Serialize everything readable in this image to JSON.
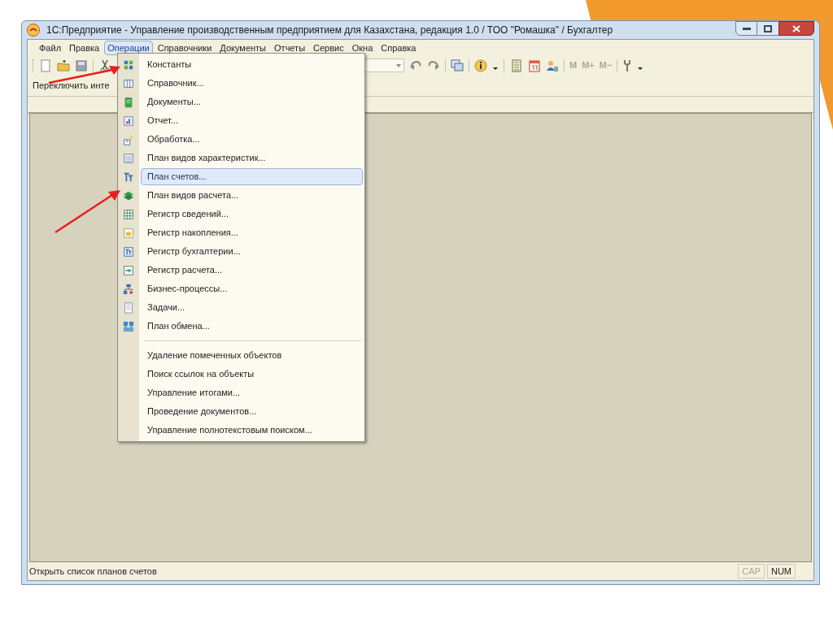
{
  "window": {
    "title": "1С:Предприятие - Управление производственным предприятием для Казахстана, редакция 1.0 / ТОО \"Ромашка\" / Бухгалтер"
  },
  "menu_bar": [
    {
      "label": "Файл",
      "selected": false
    },
    {
      "label": "Правка",
      "selected": false
    },
    {
      "label": "Операции",
      "selected": true
    },
    {
      "label": "Справочники",
      "selected": false
    },
    {
      "label": "Документы",
      "selected": false
    },
    {
      "label": "Отчеты",
      "selected": false
    },
    {
      "label": "Сервис",
      "selected": false
    },
    {
      "label": "Окна",
      "selected": false
    },
    {
      "label": "Справка",
      "selected": false
    }
  ],
  "memory_buttons": [
    {
      "label": "M",
      "disabled": true
    },
    {
      "label": "M+",
      "disabled": true
    },
    {
      "label": "M−",
      "disabled": true
    }
  ],
  "panel_button": {
    "label": "Переключить инте"
  },
  "operations_menu": [
    {
      "kind": "icon",
      "label": "Константы",
      "selected": false
    },
    {
      "kind": "icon",
      "label": "Справочник...",
      "selected": false
    },
    {
      "kind": "icon",
      "label": "Документы...",
      "selected": false
    },
    {
      "kind": "icon",
      "label": "Отчет...",
      "selected": false
    },
    {
      "kind": "icon",
      "label": "Обработка...",
      "selected": false
    },
    {
      "kind": "icon",
      "label": "План видов характеристик...",
      "selected": false
    },
    {
      "kind": "icon",
      "label": "План счетов...",
      "selected": true
    },
    {
      "kind": "icon",
      "label": "План видов расчета...",
      "selected": false
    },
    {
      "kind": "icon",
      "label": "Регистр сведений...",
      "selected": false
    },
    {
      "kind": "icon",
      "label": "Регистр накопления...",
      "selected": false
    },
    {
      "kind": "icon",
      "label": "Регистр бухгалтерии...",
      "selected": false
    },
    {
      "kind": "icon",
      "label": "Регистр расчета...",
      "selected": false
    },
    {
      "kind": "icon",
      "label": "Бизнес-процессы...",
      "selected": false
    },
    {
      "kind": "icon",
      "label": "Задачи...",
      "selected": false
    },
    {
      "kind": "icon",
      "label": "План обмена...",
      "selected": false
    },
    {
      "kind": "separator"
    },
    {
      "kind": "plain",
      "label": "Удаление помеченных объектов",
      "selected": false
    },
    {
      "kind": "plain",
      "label": "Поиск ссылок на объекты",
      "selected": false
    },
    {
      "kind": "plain",
      "label": "Управление итогами...",
      "selected": false
    },
    {
      "kind": "plain",
      "label": "Проведение документов...",
      "selected": false
    },
    {
      "kind": "plain",
      "label": "Управление полнотекстовым поиском...",
      "selected": false
    }
  ],
  "status_bar": {
    "text": "Открыть список планов счетов",
    "indicators": [
      {
        "label": "CAP",
        "on": false
      },
      {
        "label": "NUM",
        "on": true
      }
    ]
  }
}
